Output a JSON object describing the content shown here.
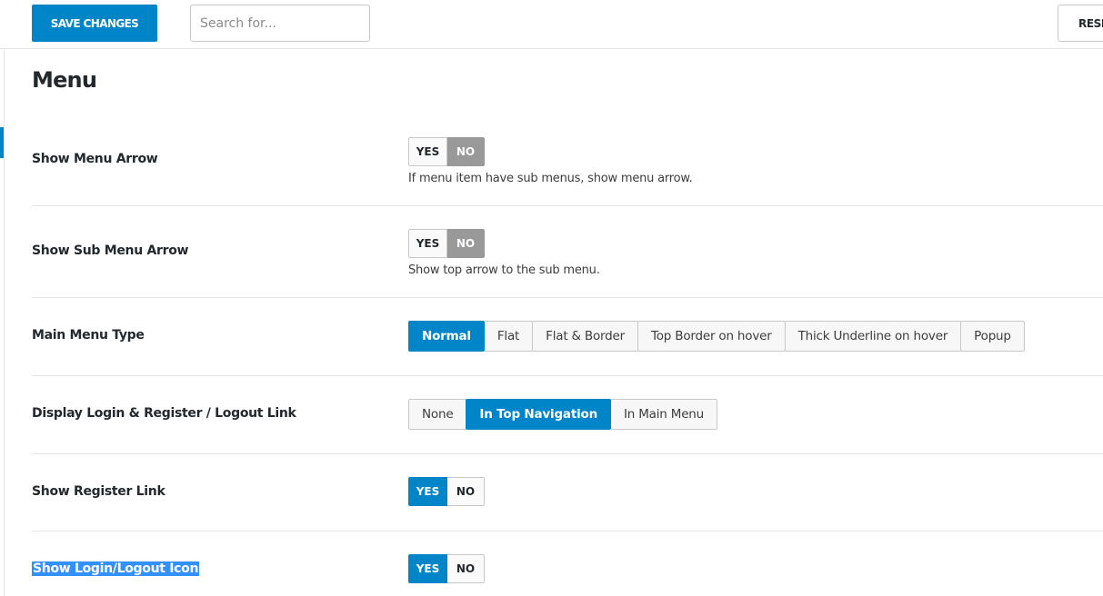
{
  "toolbar": {
    "save_label": "SAVE CHANGES",
    "search_placeholder": "Search for...",
    "reset_label": "RESET"
  },
  "page": {
    "title": "Menu"
  },
  "settings": {
    "show_menu_arrow": {
      "label": "Show Menu Arrow",
      "yes": "YES",
      "no": "NO",
      "value": "NO",
      "description": "If menu item have sub menus, show menu arrow."
    },
    "show_sub_menu_arrow": {
      "label": "Show Sub Menu Arrow",
      "yes": "YES",
      "no": "NO",
      "value": "NO",
      "description": "Show top arrow to the sub menu."
    },
    "main_menu_type": {
      "label": "Main Menu Type",
      "options": [
        "Normal",
        "Flat",
        "Flat & Border",
        "Top Border on hover",
        "Thick Underline on hover",
        "Popup"
      ],
      "value": "Normal"
    },
    "display_login_register": {
      "label": "Display Login & Register / Logout Link",
      "options": [
        "None",
        "In Top Navigation",
        "In Main Menu"
      ],
      "value": "In Top Navigation"
    },
    "show_register_link": {
      "label": "Show Register Link",
      "yes": "YES",
      "no": "NO",
      "value": "YES"
    },
    "show_login_logout_icon": {
      "label": "Show Login/Logout Icon",
      "yes": "YES",
      "no": "NO",
      "value": "YES"
    }
  },
  "colors": {
    "accent": "#0085c8",
    "inactive_toggle": "#999999",
    "selection_highlight": "#3390ff"
  }
}
